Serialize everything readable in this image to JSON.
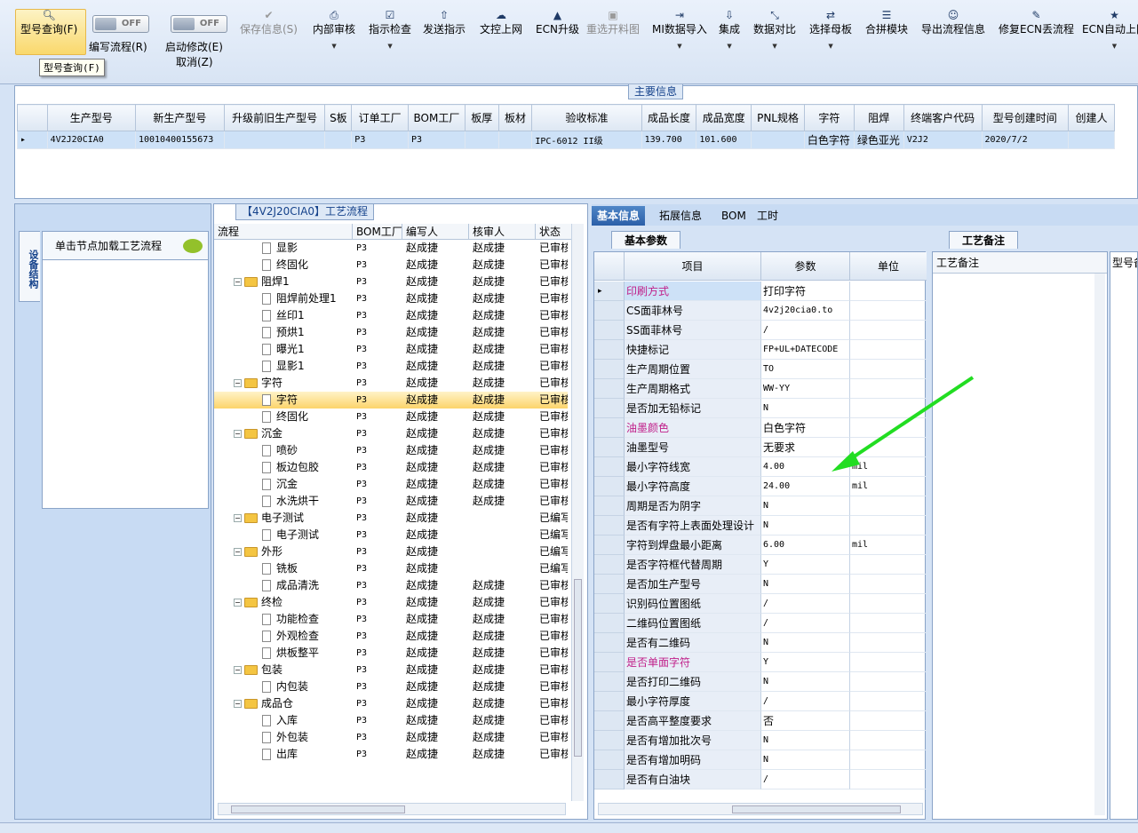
{
  "toolbar": {
    "query": "型号查询(F)",
    "write_flow": "编写流程(R)",
    "start_modify": "启动修改(E)",
    "cancel": "取消(Z)",
    "toggle_off": "OFF",
    "save": "保存信息(S)",
    "internal_review": "内部审核",
    "instruct_check": "指示检查",
    "send_instruct": "发送指示",
    "upload_doc": "文控上网",
    "ecn_upgrade": "ECN升级",
    "reselect_cut": "重选开料图",
    "mi_import": "MI数据导入",
    "integrate": "集成",
    "data_compare": "数据对比",
    "select_mother": "选择母板",
    "merge_module": "合拼模块",
    "export_flow": "导出流程信息",
    "fix_ecn": "修复ECN丢流程",
    "ecn_auto": "ECN自动上网",
    "tooltip": "型号查询(F)"
  },
  "main_info": {
    "title": "主要信息",
    "columns": [
      "生产型号",
      "新生产型号",
      "升级前旧生产型号",
      "S板",
      "订单工厂",
      "BOM工厂",
      "板厚",
      "板材",
      "验收标准",
      "成品长度",
      "成品宽度",
      "PNL规格",
      "字符",
      "阻焊",
      "终端客户代码",
      "型号创建时间",
      "创建人"
    ],
    "row": [
      "4V2J20CIA0",
      "10010400155673",
      "",
      "",
      "P3",
      "P3",
      "",
      "",
      "IPC-6012 II级",
      "139.700",
      "101.600",
      "",
      "白色字符",
      "绿色亚光",
      "V2J2",
      "2020/7/2",
      ""
    ]
  },
  "left_panel": {
    "tab": "设备结构",
    "header": "单击节点加载工艺流程"
  },
  "flow": {
    "title": "【4V2J20CIA0】工艺流程",
    "columns": [
      "流程",
      "BOM工厂",
      "编写人",
      "核审人",
      "状态"
    ],
    "rows": [
      {
        "name": "显影",
        "level": 2,
        "type": "doc",
        "bom": "P3",
        "writer": "赵成捷",
        "reviewer": "赵成捷",
        "status": "已审核"
      },
      {
        "name": "终固化",
        "level": 2,
        "type": "doc",
        "bom": "P3",
        "writer": "赵成捷",
        "reviewer": "赵成捷",
        "status": "已审核"
      },
      {
        "name": "阻焊1",
        "level": 1,
        "type": "folder",
        "bom": "P3",
        "writer": "赵成捷",
        "reviewer": "赵成捷",
        "status": "已审核"
      },
      {
        "name": "阻焊前处理1",
        "level": 2,
        "type": "doc",
        "bom": "P3",
        "writer": "赵成捷",
        "reviewer": "赵成捷",
        "status": "已审核"
      },
      {
        "name": "丝印1",
        "level": 2,
        "type": "doc",
        "bom": "P3",
        "writer": "赵成捷",
        "reviewer": "赵成捷",
        "status": "已审核"
      },
      {
        "name": "预烘1",
        "level": 2,
        "type": "doc",
        "bom": "P3",
        "writer": "赵成捷",
        "reviewer": "赵成捷",
        "status": "已审核"
      },
      {
        "name": "曝光1",
        "level": 2,
        "type": "doc",
        "bom": "P3",
        "writer": "赵成捷",
        "reviewer": "赵成捷",
        "status": "已审核"
      },
      {
        "name": "显影1",
        "level": 2,
        "type": "doc",
        "bom": "P3",
        "writer": "赵成捷",
        "reviewer": "赵成捷",
        "status": "已审核"
      },
      {
        "name": "字符",
        "level": 1,
        "type": "folder",
        "bom": "P3",
        "writer": "赵成捷",
        "reviewer": "赵成捷",
        "status": "已审核"
      },
      {
        "name": "字符",
        "level": 2,
        "type": "doc",
        "bom": "P3",
        "writer": "赵成捷",
        "reviewer": "赵成捷",
        "status": "已审核",
        "selected": true
      },
      {
        "name": "终固化",
        "level": 2,
        "type": "doc",
        "bom": "P3",
        "writer": "赵成捷",
        "reviewer": "赵成捷",
        "status": "已审核"
      },
      {
        "name": "沉金",
        "level": 1,
        "type": "folder",
        "bom": "P3",
        "writer": "赵成捷",
        "reviewer": "赵成捷",
        "status": "已审核"
      },
      {
        "name": "喷砂",
        "level": 2,
        "type": "doc",
        "bom": "P3",
        "writer": "赵成捷",
        "reviewer": "赵成捷",
        "status": "已审核"
      },
      {
        "name": "板边包胶",
        "level": 2,
        "type": "doc",
        "bom": "P3",
        "writer": "赵成捷",
        "reviewer": "赵成捷",
        "status": "已审核"
      },
      {
        "name": "沉金",
        "level": 2,
        "type": "doc",
        "bom": "P3",
        "writer": "赵成捷",
        "reviewer": "赵成捷",
        "status": "已审核"
      },
      {
        "name": "水洗烘干",
        "level": 2,
        "type": "doc",
        "bom": "P3",
        "writer": "赵成捷",
        "reviewer": "赵成捷",
        "status": "已审核"
      },
      {
        "name": "电子测试",
        "level": 1,
        "type": "folder",
        "bom": "P3",
        "writer": "赵成捷",
        "reviewer": "",
        "status": "已编写"
      },
      {
        "name": "电子测试",
        "level": 2,
        "type": "doc",
        "bom": "P3",
        "writer": "赵成捷",
        "reviewer": "",
        "status": "已编写"
      },
      {
        "name": "外形",
        "level": 1,
        "type": "folder",
        "bom": "P3",
        "writer": "赵成捷",
        "reviewer": "",
        "status": "已编写"
      },
      {
        "name": "铣板",
        "level": 2,
        "type": "doc",
        "bom": "P3",
        "writer": "赵成捷",
        "reviewer": "",
        "status": "已编写"
      },
      {
        "name": "成品清洗",
        "level": 2,
        "type": "doc",
        "bom": "P3",
        "writer": "赵成捷",
        "reviewer": "赵成捷",
        "status": "已审核"
      },
      {
        "name": "终检",
        "level": 1,
        "type": "folder",
        "bom": "P3",
        "writer": "赵成捷",
        "reviewer": "赵成捷",
        "status": "已审核"
      },
      {
        "name": "功能检查",
        "level": 2,
        "type": "doc",
        "bom": "P3",
        "writer": "赵成捷",
        "reviewer": "赵成捷",
        "status": "已审核"
      },
      {
        "name": "外观检查",
        "level": 2,
        "type": "doc",
        "bom": "P3",
        "writer": "赵成捷",
        "reviewer": "赵成捷",
        "status": "已审核"
      },
      {
        "name": "烘板整平",
        "level": 2,
        "type": "doc",
        "bom": "P3",
        "writer": "赵成捷",
        "reviewer": "赵成捷",
        "status": "已审核"
      },
      {
        "name": "包装",
        "level": 1,
        "type": "folder",
        "bom": "P3",
        "writer": "赵成捷",
        "reviewer": "赵成捷",
        "status": "已审核"
      },
      {
        "name": "内包装",
        "level": 2,
        "type": "doc",
        "bom": "P3",
        "writer": "赵成捷",
        "reviewer": "赵成捷",
        "status": "已审核"
      },
      {
        "name": "成品仓",
        "level": 1,
        "type": "folder",
        "bom": "P3",
        "writer": "赵成捷",
        "reviewer": "赵成捷",
        "status": "已审核"
      },
      {
        "name": "入库",
        "level": 2,
        "type": "doc",
        "bom": "P3",
        "writer": "赵成捷",
        "reviewer": "赵成捷",
        "status": "已审核"
      },
      {
        "name": "外包装",
        "level": 2,
        "type": "doc",
        "bom": "P3",
        "writer": "赵成捷",
        "reviewer": "赵成捷",
        "status": "已审核"
      },
      {
        "name": "出库",
        "level": 2,
        "type": "doc",
        "bom": "P3",
        "writer": "赵成捷",
        "reviewer": "赵成捷",
        "status": "已审核"
      }
    ]
  },
  "right_tabs": [
    "基本信息",
    "拓展信息",
    "BOM",
    "工时"
  ],
  "params": {
    "subtab": "基本参数",
    "columns": [
      "项目",
      "参数",
      "单位"
    ],
    "rows": [
      {
        "item": "印刷方式",
        "value": "打印字符",
        "unit": "",
        "pink": true,
        "current": true
      },
      {
        "item": "CS面菲林号",
        "value": "4v2j20cia0.to",
        "unit": ""
      },
      {
        "item": "SS面菲林号",
        "value": "/",
        "unit": ""
      },
      {
        "item": "快捷标记",
        "value": "FP+UL+DATECODE",
        "unit": ""
      },
      {
        "item": "生产周期位置",
        "value": "TO",
        "unit": ""
      },
      {
        "item": "生产周期格式",
        "value": "WW-YY",
        "unit": ""
      },
      {
        "item": "是否加无铅标记",
        "value": "N",
        "unit": ""
      },
      {
        "item": "油墨颜色",
        "value": "白色字符",
        "unit": "",
        "pink": true
      },
      {
        "item": "油墨型号",
        "value": "无要求",
        "unit": ""
      },
      {
        "item": "最小字符线宽",
        "value": "4.00",
        "unit": "mil"
      },
      {
        "item": "最小字符高度",
        "value": "24.00",
        "unit": "mil"
      },
      {
        "item": "周期是否为阴字",
        "value": "N",
        "unit": ""
      },
      {
        "item": "是否有字符上表面处理设计",
        "value": "N",
        "unit": ""
      },
      {
        "item": "字符到焊盘最小距离",
        "value": "6.00",
        "unit": "mil"
      },
      {
        "item": "是否字符框代替周期",
        "value": "Y",
        "unit": ""
      },
      {
        "item": "是否加生产型号",
        "value": "N",
        "unit": ""
      },
      {
        "item": "识别码位置图纸",
        "value": "/",
        "unit": ""
      },
      {
        "item": "二维码位置图纸",
        "value": "/",
        "unit": ""
      },
      {
        "item": "是否有二维码",
        "value": "N",
        "unit": ""
      },
      {
        "item": "是否单面字符",
        "value": "Y",
        "unit": "",
        "pink": true
      },
      {
        "item": "是否打印二维码",
        "value": "N",
        "unit": ""
      },
      {
        "item": "最小字符厚度",
        "value": "/",
        "unit": ""
      },
      {
        "item": "是否高平整度要求",
        "value": "否",
        "unit": ""
      },
      {
        "item": "是否有增加批次号",
        "value": "N",
        "unit": ""
      },
      {
        "item": "是否有增加明码",
        "value": "N",
        "unit": ""
      },
      {
        "item": "是否有白油块",
        "value": "/",
        "unit": ""
      }
    ]
  },
  "notes": {
    "subtab": "工艺备注",
    "col1": "工艺备注",
    "col2": "型号备"
  },
  "colors": {
    "accent": "#2b5fa8",
    "pink": "#c0208a",
    "selected": "#fcd46b",
    "arrow": "#22dd22"
  }
}
